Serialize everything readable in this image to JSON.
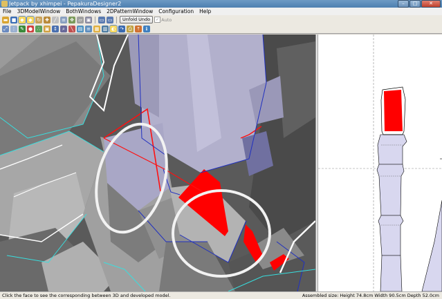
{
  "window": {
    "title": "Jetpack by xhimpei - PepakuraDesigner2",
    "min_label": "–",
    "max_label": "□",
    "close_label": "✕"
  },
  "menu": [
    "File",
    "3DModelWindow",
    "BothWindows",
    "2DPatternWindow",
    "Configuration",
    "Help"
  ],
  "toolbar": {
    "row1_icons": [
      {
        "name": "open-icon",
        "color": "#d9a531",
        "glyph": "▬"
      },
      {
        "name": "save-icon",
        "color": "#3a6db5",
        "glyph": "■"
      },
      {
        "name": "select-face-icon",
        "color": "#f6d860",
        "glyph": "◆",
        "active": true
      },
      {
        "name": "select-edge-icon",
        "color": "#e87a2a",
        "glyph": "◆",
        "active": true
      },
      {
        "name": "rotate-icon",
        "color": "#c9a25a",
        "glyph": "↻"
      },
      {
        "name": "pan-icon",
        "color": "#b98a3a",
        "glyph": "✚"
      },
      {
        "name": "edit-edge-icon",
        "color": "#c0c0c0",
        "glyph": "╱"
      },
      {
        "name": "join-edge-icon",
        "color": "#8aa0c0",
        "glyph": "≡"
      },
      {
        "name": "move-icon",
        "color": "#7a9a5a",
        "glyph": "✥"
      },
      {
        "name": "flap-icon",
        "color": "#a0a0a0",
        "glyph": "▱"
      },
      {
        "name": "unfold-icon",
        "color": "#8a8aa0",
        "glyph": "▣"
      }
    ],
    "row1_icons_b": [
      {
        "name": "window-3d-icon",
        "color": "#5a7ab0",
        "glyph": "▭"
      },
      {
        "name": "window-2d-icon",
        "color": "#5a7ab0",
        "glyph": "▭"
      }
    ],
    "unfold_undo_label": "Unfold Undo",
    "auto_label": "Auto",
    "auto_checked": "✓",
    "row2_icons": [
      {
        "name": "fit-view-icon",
        "color": "#6a8ac0",
        "glyph": "⤢"
      },
      {
        "name": "grid-icon",
        "color": "#9ab0d0",
        "glyph": "⋮"
      },
      {
        "name": "paint-icon",
        "color": "#3a8a3a",
        "glyph": "✎"
      },
      {
        "name": "color-icon",
        "color": "#d04040",
        "glyph": "●"
      },
      {
        "name": "texture-icon",
        "color": "#5aa05a",
        "glyph": "∴"
      },
      {
        "name": "image-icon",
        "color": "#d0a040",
        "glyph": "▣"
      },
      {
        "name": "scale-icon",
        "color": "#4a70b0",
        "glyph": "↕"
      },
      {
        "name": "zoom-icon",
        "color": "#6a6a9a",
        "glyph": "⌕"
      },
      {
        "name": "line-icon",
        "color": "#c05050",
        "glyph": "╲"
      },
      {
        "name": "layout-icon",
        "color": "#4a90c0",
        "glyph": "▤"
      },
      {
        "name": "pattern-icon",
        "color": "#6090c0",
        "glyph": "≡"
      },
      {
        "name": "part-icon",
        "color": "#e0b040",
        "glyph": "▦"
      },
      {
        "name": "arrange-icon",
        "color": "#4a7aa0",
        "glyph": "▥"
      },
      {
        "name": "flip-icon",
        "color": "#f0b030",
        "glyph": "◐",
        "active": true
      },
      {
        "name": "redo-icon",
        "color": "#3a6ab0",
        "glyph": "↷"
      },
      {
        "name": "print-icon",
        "color": "#c0a040",
        "glyph": "⎙"
      },
      {
        "name": "export-icon",
        "color": "#d07030",
        "glyph": "⤒"
      },
      {
        "name": "info-icon",
        "color": "#4080c0",
        "glyph": "ℹ"
      }
    ]
  },
  "status": {
    "hint": "Click the face to see the corresponding between 3D and developed model.",
    "assembled_size": "Assembled size: Height 74.8cm Width 90.5cm Depth 52.0cm"
  },
  "colors": {
    "highlight_face": "#ff0000",
    "selected_face": "#aaa8c8",
    "model_gray": "#b0b0b0",
    "edge_cyan": "#37e0e0",
    "edge_blue": "#2030c0"
  }
}
